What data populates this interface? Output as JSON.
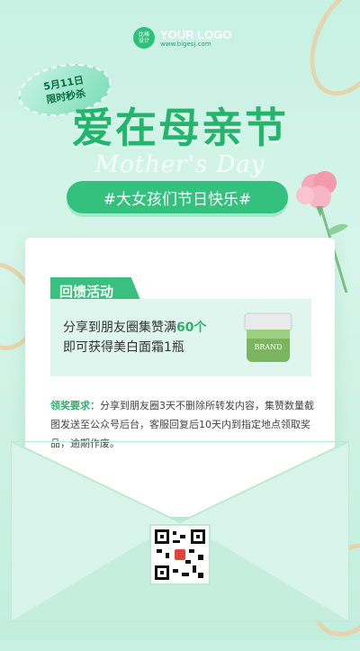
{
  "logo": {
    "badge": "比格\n设计",
    "name": "YOUR LOGO",
    "url": "www.bigesj.com"
  },
  "tag": {
    "line1": "5月11日",
    "line2": "限时秒杀"
  },
  "title": "爱在母亲节",
  "subtitle_en": "Mother's Day",
  "pill": "#大女孩们节日快乐#",
  "section_title": "回馈活动",
  "offer": {
    "line1_prefix": "分享到朋友圈集赞满",
    "line1_highlight": "60个",
    "line2": "即可获得美白面霜1瓶",
    "jar_label": "BRAND"
  },
  "requirement": {
    "label": "领奖要求：",
    "text": "分享到朋友圈3天不删除所转发内容，集赞数量截图发送至公众号后台，客服回复后10天内到指定地点领取奖品，逾期作废。"
  },
  "colors": {
    "accent": "#34c17e",
    "title": "#22b56b",
    "background": "#c8f1e3"
  }
}
